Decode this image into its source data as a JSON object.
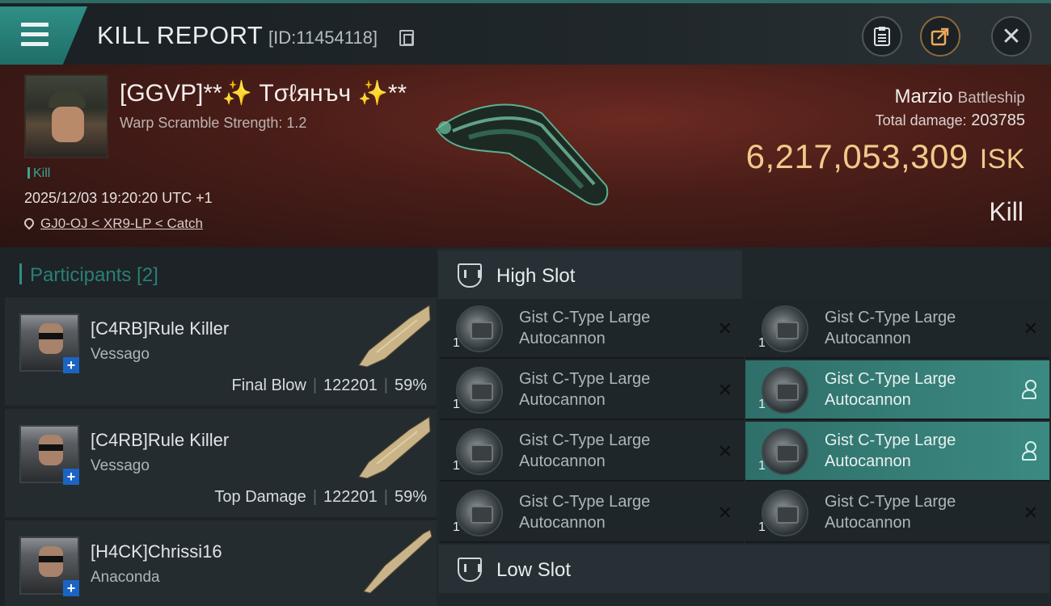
{
  "header": {
    "title": "KILL REPORT",
    "report_id": "[ID:11454118]",
    "icons": {
      "menu": "menu-icon",
      "copy": "copy-icon",
      "clipboard": "clipboard-icon",
      "share": "share-icon",
      "close": "close-icon"
    }
  },
  "victim": {
    "name": "[GGVP]**✨ Тσℓянъч ✨**",
    "warp_scramble": "Warp Scramble Strength: 1.2",
    "tag": "Kill",
    "datetime": "2025/12/03 19:20:20 UTC +1",
    "location": "GJ0-OJ < XR9-LP < Catch",
    "ship_name": "Marzio",
    "ship_class": "Battleship",
    "total_damage_label": "Total damage:",
    "total_damage": "203785",
    "isk_value": "6,217,053,309",
    "isk_currency": "ISK",
    "result": "Kill"
  },
  "participants": {
    "title": "Participants [2]",
    "items": [
      {
        "name": "[C4RB]Rule Killer",
        "ship": "Vessago",
        "role": "Final Blow",
        "damage": "122201",
        "percent": "59%"
      },
      {
        "name": "[C4RB]Rule Killer",
        "ship": "Vessago",
        "role": "Top Damage",
        "damage": "122201",
        "percent": "59%"
      },
      {
        "name": "[H4CK]Chrissi16",
        "ship": "Anaconda",
        "role": "",
        "damage": "",
        "percent": ""
      }
    ]
  },
  "slots": {
    "high_slot_title": "High Slot",
    "low_slot_title": "Low Slot",
    "high_items": [
      {
        "line1": "Gist C-Type Large",
        "line2": "Autocannon",
        "qty": "1",
        "state": "destroyed"
      },
      {
        "line1": "Gist C-Type Large",
        "line2": "Autocannon",
        "qty": "1",
        "state": "destroyed"
      },
      {
        "line1": "Gist C-Type Large",
        "line2": "Autocannon",
        "qty": "1",
        "state": "destroyed"
      },
      {
        "line1": "Gist C-Type Large",
        "line2": "Autocannon",
        "qty": "1",
        "state": "dropped"
      },
      {
        "line1": "Gist C-Type Large",
        "line2": "Autocannon",
        "qty": "1",
        "state": "destroyed"
      },
      {
        "line1": "Gist C-Type Large",
        "line2": "Autocannon",
        "qty": "1",
        "state": "dropped"
      },
      {
        "line1": "Gist C-Type Large",
        "line2": "Autocannon",
        "qty": "1",
        "state": "destroyed"
      },
      {
        "line1": "Gist C-Type Large",
        "line2": "Autocannon",
        "qty": "1",
        "state": "destroyed"
      }
    ]
  },
  "colors": {
    "accent": "#2f8f86",
    "isk": "#f1c98a",
    "banner": "#4a1d18"
  }
}
